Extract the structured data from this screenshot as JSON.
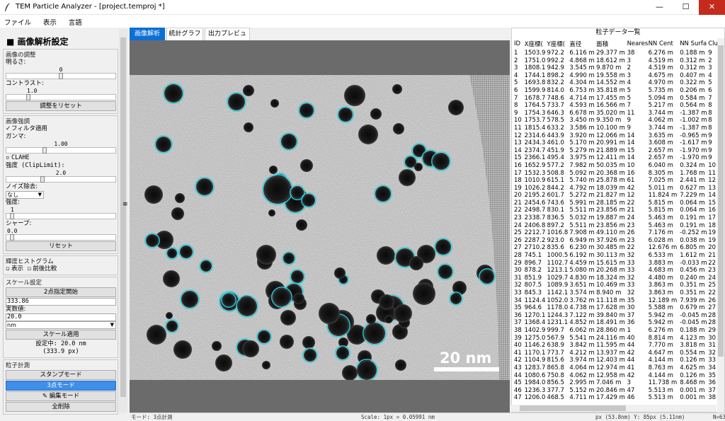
{
  "window": {
    "title": "TEM Particle Analyzer - [project.temproj *]",
    "minimize": "—",
    "maximize": "☐",
    "close": "✕"
  },
  "menu": [
    "ファイル",
    "表示",
    "言語"
  ],
  "left": {
    "title": "■ 画像解析設定",
    "adjust": {
      "label": "画像の調整",
      "brightness_label": "明るさ:",
      "brightness_value": "0",
      "brightness_level": 0.5,
      "contrast_label": "コントラスト:",
      "contrast_value": "1.0",
      "contrast_level": 0.2,
      "reset_btn": "調整をリセット"
    },
    "enhance": {
      "label": "画像強調",
      "filter_check": "フィルタ適用",
      "gamma_label": "ガンマ:",
      "gamma_value": "1.00",
      "gamma_level": 0.35,
      "clahe": "CLAHE",
      "clip_label": "強度 (ClipLimit):",
      "clip_value": "2.0",
      "clip_level": 0.33,
      "noise_label": "ノイズ除去:",
      "noise_value": "なし",
      "strength_label": "強度:",
      "strength_value": "1",
      "strength_level": 0.05,
      "sharp_label": "シャープ:",
      "sharp_value": "0.0",
      "sharp_level": 0.05,
      "reset_btn": "リセット"
    },
    "hist": {
      "label": "輝度ヒストグラム",
      "show": "表示",
      "compare": "前後比較"
    },
    "scale": {
      "label": "スケール設定",
      "two_point_btn": "2点指定開始",
      "pixel_value": "333.86",
      "real_label": "実数値:",
      "real_value": "20.0",
      "unit": "nm",
      "apply_btn": "スケール適用",
      "current": "設定中: 20.0 nm",
      "current_px": "(333.9 px)"
    },
    "measure": {
      "label": "粒子計測",
      "stamp_btn": "スタンプモード",
      "three_point_btn": "3点モード",
      "edit_btn": "✎ 編集モード",
      "clear_btn": "全削除"
    }
  },
  "tabs": [
    "画像解析",
    "統計グラフ",
    "出力プレビュー"
  ],
  "image": {
    "scale_text": "20 nm"
  },
  "table": {
    "title": "粒子データ一覧",
    "headers": [
      "ID",
      "X座標(",
      "Y座標(",
      "直径",
      "面積",
      "Neares",
      "NN Cent",
      "NN Surfa",
      "Clust"
    ],
    "rows": [
      [
        "1",
        "1503.9",
        "972.2",
        "6.116 m",
        "29.377 m",
        "38",
        "6.276 m",
        "0.188 m",
        "9"
      ],
      [
        "2",
        "1751.0",
        "992.2",
        "4.868 m",
        "18.612 m",
        "3",
        "4.519 m",
        "0.312 m",
        "2"
      ],
      [
        "3",
        "1808.1",
        "942.9",
        "3.545 m",
        "9.870 m",
        "2",
        "4.519 m",
        "0.312 m",
        "3"
      ],
      [
        "4",
        "1744.1",
        "898.2",
        "4.990 m",
        "19.558 m",
        "3",
        "4.675 m",
        "0.407 m",
        "4"
      ],
      [
        "5",
        "1693.8",
        "832.2",
        "4.304 m",
        "14.552 m",
        "4",
        "4.970 m",
        "0.322 m",
        "5"
      ],
      [
        "6",
        "1599.9",
        "814.0",
        "6.753 m",
        "35.818 m",
        "5",
        "5.735 m",
        "0.206 m",
        "6"
      ],
      [
        "7",
        "1678.7",
        "748.6",
        "4.714 m",
        "17.455 m",
        "5",
        "5.094 m",
        "0.584 m",
        "7"
      ],
      [
        "8",
        "1764.5",
        "733.7",
        "4.593 m",
        "16.566 m",
        "7",
        "5.217 m",
        "0.564 m",
        "8"
      ],
      [
        "9",
        "1754.3",
        "646.3",
        "6.678 m",
        "35.020 m",
        "11",
        "3.744 m",
        "-1.387 m",
        "8"
      ],
      [
        "10",
        "1753.7",
        "578.5",
        "3.450 m",
        "9.350 m",
        "9",
        "4.062 m",
        "-1.002 m",
        "8"
      ],
      [
        "11",
        "1815.4",
        "633.2",
        "3.586 m",
        "10.100 m",
        "9",
        "3.744 m",
        "-1.387 m",
        "8"
      ],
      [
        "12",
        "2314.6",
        "443.9",
        "3.920 m",
        "12.066 m",
        "14",
        "3.635 m",
        "-0.965 m",
        "9"
      ],
      [
        "13",
        "2434.3",
        "461.0",
        "5.170 m",
        "20.991 m",
        "14",
        "3.608 m",
        "-1.617 m",
        "9"
      ],
      [
        "14",
        "2374.7",
        "451.9",
        "5.279 m",
        "21.889 m",
        "15",
        "2.657 m",
        "-1.970 m",
        "9"
      ],
      [
        "15",
        "2366.1",
        "495.4",
        "3.975 m",
        "12.411 m",
        "14",
        "2.657 m",
        "-1.970 m",
        "9"
      ],
      [
        "16",
        "1652.9",
        "577.2",
        "7.982 m",
        "50.035 m",
        "10",
        "6.040 m",
        "0.324 m",
        "10"
      ],
      [
        "17",
        "1532.3",
        "508.8",
        "5.092 m",
        "20.368 m",
        "16",
        "8.305 m",
        "1.768 m",
        "11"
      ],
      [
        "18",
        "1010.9",
        "615.1",
        "5.740 m",
        "25.878 m",
        "61",
        "7.025 m",
        "2.441 m",
        "12"
      ],
      [
        "19",
        "1026.2",
        "844.2",
        "4.792 m",
        "18.039 m",
        "42",
        "5.011 m",
        "0.627 m",
        "13"
      ],
      [
        "20",
        "2195.2",
        "601.7",
        "5.272 m",
        "21.827 m",
        "12",
        "11.824 m",
        "7.229 m",
        "14"
      ],
      [
        "21",
        "2454.6",
        "743.6",
        "5.991 m",
        "28.185 m",
        "22",
        "5.815 m",
        "0.064 m",
        "15"
      ],
      [
        "22",
        "2498.7",
        "830.1",
        "5.511 m",
        "23.856 m",
        "21",
        "5.815 m",
        "0.064 m",
        "16"
      ],
      [
        "23",
        "2338.7",
        "836.5",
        "5.032 m",
        "19.887 m",
        "24",
        "5.463 m",
        "0.191 m",
        "17"
      ],
      [
        "24",
        "2406.8",
        "897.2",
        "5.511 m",
        "23.856 m",
        "23",
        "5.463 m",
        "0.191 m",
        "18"
      ],
      [
        "25",
        "2212.7",
        "1016.8",
        "7.908 m",
        "49.110 m",
        "26",
        "7.176 m",
        "-0.252 m",
        "19"
      ],
      [
        "26",
        "2287.2",
        "923.0",
        "6.949 m",
        "37.926 m",
        "23",
        "6.028 m",
        "0.038 m",
        "19"
      ],
      [
        "27",
        "2710.2",
        "835.6",
        "6.230 m",
        "30.485 m",
        "22",
        "12.676 m",
        "6.805 m",
        "20"
      ],
      [
        "28",
        "745.1",
        "1000.5",
        "6.192 m",
        "30.113 m",
        "32",
        "6.533 m",
        "1.612 m",
        "21"
      ],
      [
        "29",
        "896.7",
        "1102.7",
        "4.459 m",
        "15.615 m",
        "33",
        "3.883 m",
        "-0.033 m",
        "22"
      ],
      [
        "30",
        "878.2",
        "1213.1",
        "5.080 m",
        "20.268 m",
        "33",
        "4.683 m",
        "0.456 m",
        "23"
      ],
      [
        "31",
        "851.9",
        "1029.7",
        "4.830 m",
        "18.324 m",
        "32",
        "4.480 m",
        "0.240 m",
        "24"
      ],
      [
        "32",
        "807.5",
        "1089.9",
        "3.651 m",
        "10.469 m",
        "33",
        "3.863 m",
        "0.351 m",
        "25"
      ],
      [
        "33",
        "845.3",
        "1142.1",
        "3.574 m",
        "8.940 m",
        "32",
        "3.863 m",
        "0.351 m",
        "22"
      ],
      [
        "34",
        "1124.4",
        "1052.0",
        "3.762 m",
        "11.118 m",
        "35",
        "12.189 m",
        "7.939 m",
        "26"
      ],
      [
        "35",
        "964.6",
        "1178.0",
        "4.738 m",
        "17.628 m",
        "30",
        "5.588 m",
        "0.679 m",
        "27"
      ],
      [
        "36",
        "1270.1",
        "1244.3",
        "7.122 m",
        "39.840 m",
        "37",
        "5.942 m",
        "-0.045 m",
        "28"
      ],
      [
        "37",
        "1368.4",
        "1231.1",
        "4.852 m",
        "18.491 m",
        "36",
        "5.942 m",
        "-0.045 m",
        "28"
      ],
      [
        "38",
        "1402.9",
        "999.7",
        "6.062 m",
        "28.860 m",
        "1",
        "6.276 m",
        "0.188 m",
        "29"
      ],
      [
        "39",
        "1275.0",
        "567.9",
        "5.541 m",
        "24.116 m",
        "40",
        "8.814 m",
        "4.123 m",
        "30"
      ],
      [
        "40",
        "1146.2",
        "638.9",
        "3.842 m",
        "11.595 m",
        "44",
        "7.770 m",
        "3.818 m",
        "31"
      ],
      [
        "41",
        "1170.1",
        "773.7",
        "4.212 m",
        "13.937 m",
        "42",
        "4.647 m",
        "0.554 m",
        "32"
      ],
      [
        "42",
        "1104.9",
        "815.6",
        "3.974 m",
        "12.403 m",
        "44",
        "4.144 m",
        "0.126 m",
        "33"
      ],
      [
        "43",
        "1283.7",
        "865.8",
        "4.064 m",
        "12.974 m",
        "41",
        "8.763 m",
        "4.625 m",
        "34"
      ],
      [
        "44",
        "1080.6",
        "750.8",
        "4.062 m",
        "12.958 m",
        "42",
        "4.144 m",
        "0.126 m",
        "35"
      ],
      [
        "45",
        "1984.0",
        "856.5",
        "2.995 m",
        "7.046 m",
        "3",
        "11.738 m",
        "8.468 m",
        "36"
      ],
      [
        "46",
        "1236.3",
        "377.7",
        "5.152 m",
        "20.846 m",
        "47",
        "5.513 m",
        "0.001 m",
        "37"
      ],
      [
        "47",
        "1206.0",
        "468.5",
        "4.711 m",
        "17.429 m",
        "46",
        "5.513 m",
        "0.001 m",
        "38"
      ]
    ]
  },
  "status": {
    "mode": "モード: 3点計測",
    "scale": "Scale: 1px = 0.05991 nm",
    "pos": "px (53.8nm)   Y: 85px (5.11nm)",
    "count": "N=63"
  }
}
